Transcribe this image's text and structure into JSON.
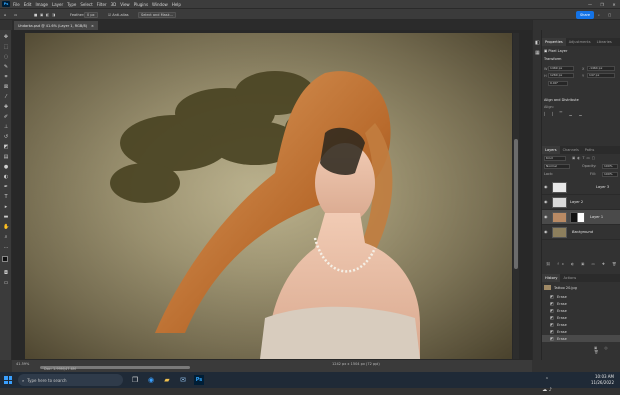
{
  "menubar": {
    "app_logo": "Ps",
    "items": [
      "File",
      "Edit",
      "Image",
      "Layer",
      "Type",
      "Select",
      "Filter",
      "3D",
      "View",
      "Plugins",
      "Window",
      "Help"
    ],
    "window_controls": [
      "—",
      "❐",
      "✕"
    ]
  },
  "options_bar": {
    "feather_label": "Feather:",
    "feather_value": "0 px",
    "anti_alias_label": "Anti-alias",
    "select_mask_label": "Select and Mask...",
    "share_label": "Share"
  },
  "document": {
    "tab_title": "Undarka.psd @ 41.6% (Layer 1, RGB/8)",
    "tab_close": "×"
  },
  "status_bar": {
    "zoom": "41.59%",
    "doc_info": "Doc: 1.99M/47.6M",
    "doc_info_right": "1242 px x 1504 px (72 ppi)"
  },
  "properties_panel": {
    "tabs": [
      "Properties",
      "Adjustments",
      "Libraries"
    ],
    "layer_type": "Pixel Layer",
    "transform_title": "Transform",
    "w_label": "W",
    "w_value": "1469 px",
    "x_label": "X",
    "x_value": "-1464 px",
    "h_label": "H",
    "h_value": "1260 px",
    "y_label": "Y",
    "y_value": "147 px",
    "angle_value": "0.00°",
    "align_title": "Align and Distribute",
    "align_sub": "Align:"
  },
  "layers_panel": {
    "tabs": [
      "Layers",
      "Channels",
      "Paths"
    ],
    "kind_label": "Kind",
    "blend_mode": "Normal",
    "opacity_label": "Opacity:",
    "opacity_value": "100%",
    "lock_label": "Lock:",
    "fill_label": "Fill:",
    "fill_value": "100%",
    "layers": [
      {
        "name": "Layer 3",
        "thumb": "#e8e8e8",
        "has_mask": false
      },
      {
        "name": "Layer 2",
        "thumb": "#d9d9d9",
        "has_mask": false
      },
      {
        "name": "Layer 1",
        "thumb": "#b98a64",
        "has_mask": true
      },
      {
        "name": "Background",
        "thumb": "#8d7f5d",
        "has_mask": false
      }
    ]
  },
  "history_panel": {
    "tabs": [
      "History",
      "Actions"
    ],
    "snapshot": "Tattoo 20.jpg",
    "items": [
      "Erase",
      "Erase",
      "Erase",
      "Erase",
      "Erase",
      "Erase",
      "Erase"
    ]
  },
  "taskbar": {
    "search_placeholder": "Type here to search",
    "time": "10:03 AM",
    "date": "11/26/2022"
  },
  "colors": {
    "accent": "#1473e6",
    "panel_bg": "#323232",
    "canvas_bg": "#282828"
  }
}
